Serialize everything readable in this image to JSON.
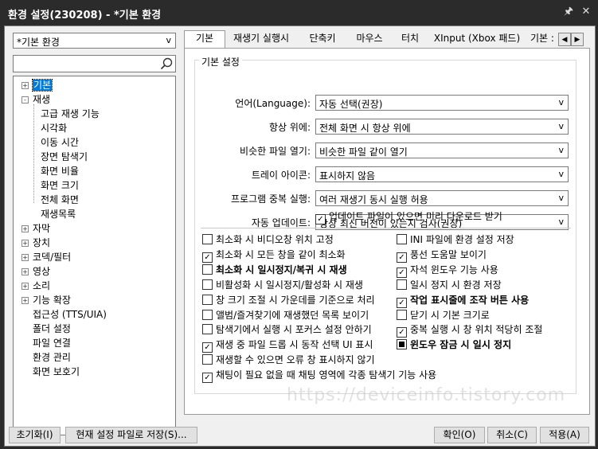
{
  "window": {
    "title": "환경 설정(230208) - *기본 환경",
    "pin_icon": "pin-icon",
    "close_icon": "close-icon"
  },
  "profile_select": {
    "value": "*기본 환경"
  },
  "search": {
    "placeholder": "",
    "icon": "search-icon"
  },
  "tree": [
    {
      "label": "기본",
      "indent": 0,
      "expander": "+",
      "selected": true
    },
    {
      "label": "재생",
      "indent": 0,
      "expander": "-"
    },
    {
      "label": "고급 재생 기능",
      "indent": 1
    },
    {
      "label": "시각화",
      "indent": 1
    },
    {
      "label": "이동 시간",
      "indent": 1
    },
    {
      "label": "장면 탐색기",
      "indent": 1
    },
    {
      "label": "화면 비율",
      "indent": 1
    },
    {
      "label": "화면 크기",
      "indent": 1
    },
    {
      "label": "전체 화면",
      "indent": 1
    },
    {
      "label": "재생목록",
      "indent": 1
    },
    {
      "label": "자막",
      "indent": 0,
      "expander": "+"
    },
    {
      "label": "장치",
      "indent": 0,
      "expander": "+"
    },
    {
      "label": "코덱/필터",
      "indent": 0,
      "expander": "+"
    },
    {
      "label": "영상",
      "indent": 0,
      "expander": "+"
    },
    {
      "label": "소리",
      "indent": 0,
      "expander": "+"
    },
    {
      "label": "기능 확장",
      "indent": 0,
      "expander": "+"
    },
    {
      "label": "접근성 (TTS/UIA)",
      "indent": 0
    },
    {
      "label": "폴더 설정",
      "indent": 0
    },
    {
      "label": "파일 연결",
      "indent": 0
    },
    {
      "label": "환경 관리",
      "indent": 0
    },
    {
      "label": "화면 보호기",
      "indent": 0
    }
  ],
  "tabs": [
    "기본",
    "재생기 실행시",
    "단축키",
    "마우스",
    "터치",
    "XInput (Xbox 패드)",
    "기본 :"
  ],
  "tab_scroll": {
    "left": "◀",
    "right": "▶"
  },
  "group_title": "기본 설정",
  "settings": [
    {
      "label": "언어(Language):",
      "value": "자동 선택(권장)"
    },
    {
      "label": "항상 위에:",
      "value": "전체 화면 시 항상 위에"
    },
    {
      "label": "비슷한 파일 열기:",
      "value": "비슷한 파일 같이 열기"
    },
    {
      "label": "트레이 아이콘:",
      "value": "표시하지 않음"
    },
    {
      "label": "프로그램 중복 실행:",
      "value": "여러 재생기 동시 실행 허용"
    },
    {
      "label": "자동 업데이트:",
      "value": "항상 최신 버전이 있는지 검사(권장)"
    }
  ],
  "combo_arrow": "v",
  "update_checkbox": {
    "label": "업데이트 파일이 있으면 미리 다운로드 받기",
    "checked": true
  },
  "options_left": [
    {
      "label": "최소화 시 비디오창 위치 고정",
      "checked": false,
      "bold": false
    },
    {
      "label": "최소화 시 모든 창을 같이 최소화",
      "checked": true,
      "bold": false
    },
    {
      "label": "최소화 시 일시정지/복귀 시 재생",
      "checked": false,
      "bold": true
    },
    {
      "label": "비활성화 시 일시정지/활성화 시 재생",
      "checked": false,
      "bold": false
    },
    {
      "label": "창 크기 조절 시 가운데를 기준으로 처리",
      "checked": false,
      "bold": false
    },
    {
      "label": "앨범/즐겨찾기에 재생했던 목록 보이기",
      "checked": false,
      "bold": false
    },
    {
      "label": "탐색기에서 실행 시 포커스 설정 안하기",
      "checked": false,
      "bold": false
    },
    {
      "label": "재생 중 파일 드롭 시 동작 선택 UI 표시",
      "checked": true,
      "bold": false
    },
    {
      "label": "재생할 수 있으면 오류 창 표시하지 않기",
      "checked": false,
      "bold": false
    },
    {
      "label": "채팅이 필요 없을 때 채팅 영역에 각종 탐색기 기능 사용",
      "checked": true,
      "bold": false
    }
  ],
  "options_right": [
    {
      "label": "INI 파일에 환경 설정 저장",
      "checked": false,
      "bold": false
    },
    {
      "label": "풍선 도움말 보이기",
      "checked": true,
      "bold": false
    },
    {
      "label": "자석 윈도우 기능 사용",
      "checked": true,
      "bold": false
    },
    {
      "label": "일시 정지 시 환경 저장",
      "checked": false,
      "bold": false
    },
    {
      "label": "작업 표시줄에 조작 버튼 사용",
      "checked": true,
      "bold": true
    },
    {
      "label": "닫기 시 기본 크기로",
      "checked": false,
      "bold": false
    },
    {
      "label": "중복 실행 시 창 위치 적당히 조절",
      "checked": true,
      "bold": false
    },
    {
      "label": "윈도우 잠금 시 일시 정지",
      "checked": "partial",
      "bold": true
    }
  ],
  "watermark": "https://deviceinfo.tistory.com",
  "buttons": {
    "reset": "초기화(I)",
    "save_file": "현재 설정 파일로 저장(S)...",
    "ok": "확인(O)",
    "cancel": "취소(C)",
    "apply": "적용(A)"
  },
  "colors": {
    "selection": "#0078d7",
    "titlebar": "#2b2b2b"
  }
}
